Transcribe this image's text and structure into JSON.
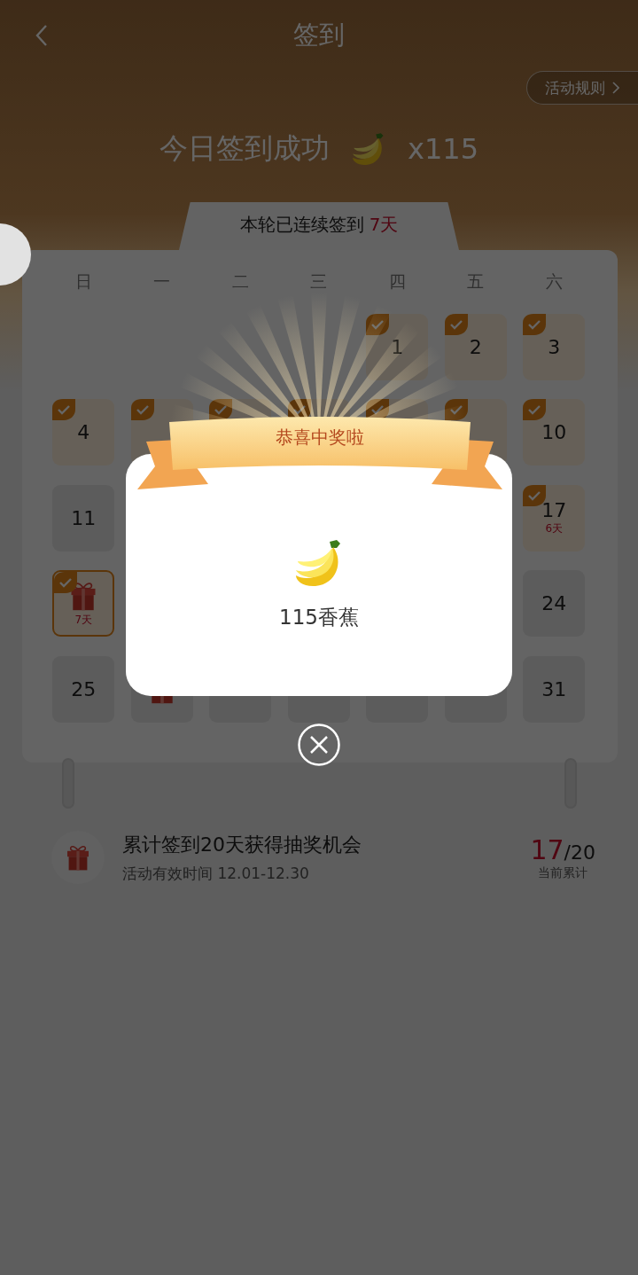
{
  "header": {
    "title": "签到",
    "rules_button": "活动规则"
  },
  "success": {
    "text": "今日签到成功",
    "amount": "x115"
  },
  "streak_tab": {
    "text": "本轮已连续签到",
    "count": "7天"
  },
  "calendar": {
    "weekdays": [
      "日",
      "一",
      "二",
      "三",
      "四",
      "五",
      "六"
    ],
    "weeks": [
      [
        {
          "kind": "blank"
        },
        {
          "kind": "blank"
        },
        {
          "kind": "blank"
        },
        {
          "kind": "blank"
        },
        {
          "kind": "day",
          "day": "1",
          "checked": true,
          "highlighted": false
        },
        {
          "kind": "day",
          "day": "2",
          "checked": true,
          "highlighted": false
        },
        {
          "kind": "day",
          "day": "3",
          "checked": true,
          "highlighted": false
        }
      ],
      [
        {
          "kind": "day",
          "day": "4",
          "checked": true,
          "highlighted": false
        },
        {
          "kind": "day",
          "checked": true,
          "highlighted": false
        },
        {
          "kind": "day",
          "checked": true,
          "highlighted": false
        },
        {
          "kind": "day",
          "checked": true,
          "highlighted": false
        },
        {
          "kind": "day",
          "checked": true,
          "highlighted": false
        },
        {
          "kind": "day",
          "checked": true,
          "highlighted": false
        },
        {
          "kind": "day",
          "day": "10",
          "checked": true,
          "highlighted": false
        }
      ],
      [
        {
          "kind": "day",
          "day": "11",
          "checked": false,
          "highlighted": false
        },
        {
          "kind": "blank"
        },
        {
          "kind": "blank"
        },
        {
          "kind": "blank"
        },
        {
          "kind": "blank"
        },
        {
          "kind": "blank"
        },
        {
          "kind": "day",
          "day": "17",
          "note": "6天",
          "checked": true,
          "highlighted": false
        }
      ],
      [
        {
          "kind": "gift",
          "note": "7天",
          "checked": true,
          "highlighted": true
        },
        {
          "kind": "blank"
        },
        {
          "kind": "blank"
        },
        {
          "kind": "blank"
        },
        {
          "kind": "blank"
        },
        {
          "kind": "blank"
        },
        {
          "kind": "day",
          "day": "24",
          "checked": false,
          "highlighted": false
        }
      ],
      [
        {
          "kind": "day",
          "day": "25",
          "checked": false,
          "highlighted": false
        },
        {
          "kind": "gift",
          "checked": false,
          "highlighted": false
        },
        {
          "kind": "day",
          "checked": false,
          "highlighted": false
        },
        {
          "kind": "day",
          "checked": false,
          "highlighted": false
        },
        {
          "kind": "day",
          "checked": false,
          "highlighted": false
        },
        {
          "kind": "day",
          "checked": false,
          "highlighted": false
        },
        {
          "kind": "day",
          "day": "31",
          "checked": false,
          "highlighted": false
        }
      ]
    ]
  },
  "reward_info": {
    "title": "累计签到20天获得抽奖机会",
    "subtitle": "活动有效时间 12.01-12.30",
    "current": "17",
    "target": "/20",
    "caption": "当前累计"
  },
  "prize_dialog": {
    "title": "恭喜中奖啦",
    "prize": "115香蕉"
  }
}
